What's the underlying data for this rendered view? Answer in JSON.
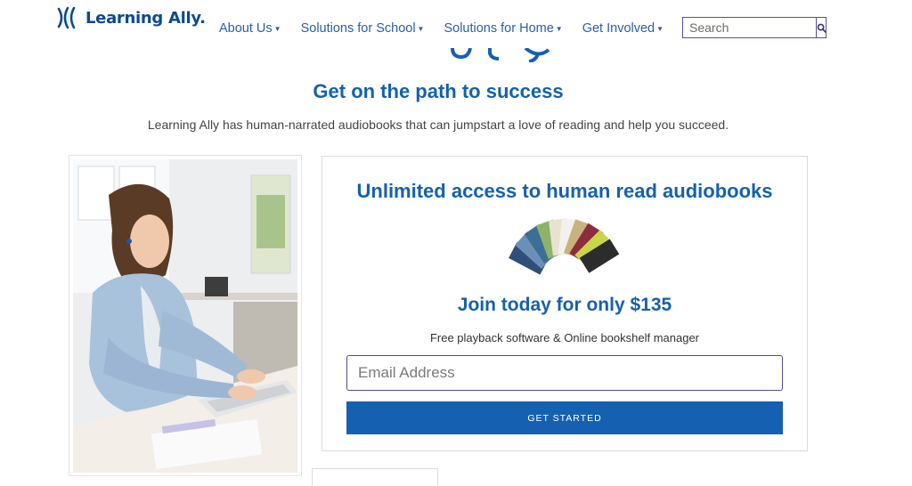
{
  "header": {
    "logo_text": "Learning Ally.",
    "nav": [
      {
        "label": "About Us"
      },
      {
        "label": "Solutions for School"
      },
      {
        "label": "Solutions for Home"
      },
      {
        "label": "Get Involved"
      }
    ],
    "search": {
      "placeholder": "Search"
    }
  },
  "hero": {
    "title": "Get on the path to success",
    "lead": "Learning Ally has human-narrated audiobooks that can jumpstart a love of reading and help you succeed."
  },
  "card": {
    "title": "Unlimited access to human read audiobooks",
    "price_line": "Join today for only $135",
    "subtitle": "Free playback software & Online bookshelf manager",
    "email_placeholder": "Email Address",
    "cta_label": "GET STARTED"
  },
  "icons": [
    "logo-sound-icon",
    "search-icon",
    "chevron-down-icon"
  ],
  "colors": {
    "brand_blue": "#1561ad",
    "accent_purple": "#564b92",
    "button_blue": "#1561b0"
  }
}
